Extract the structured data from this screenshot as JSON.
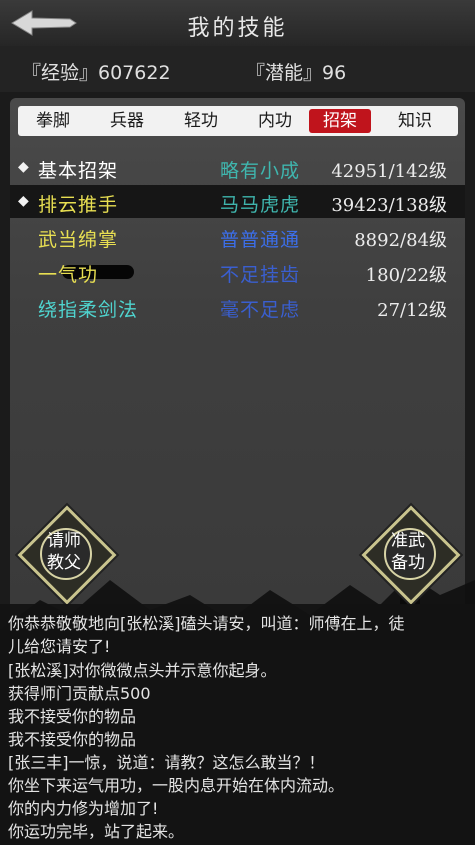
{
  "header": {
    "title": "我的技能",
    "back_icon": "back-arrow-icon"
  },
  "stats": {
    "experience": "『经验』607622",
    "potential": "『潜能』96"
  },
  "tabs": [
    {
      "label": "拳脚",
      "active": false
    },
    {
      "label": "兵器",
      "active": false
    },
    {
      "label": "轻功",
      "active": false
    },
    {
      "label": "内功",
      "active": false
    },
    {
      "label": "招架",
      "active": true
    },
    {
      "label": "知识",
      "active": false
    }
  ],
  "skills": [
    {
      "name": "基本招架",
      "grade": "略有小成",
      "level": "42951/142级",
      "marker": "◆",
      "selected": false
    },
    {
      "name": "排云推手",
      "grade": "马马虎虎",
      "level": "39423/138级",
      "marker": "◆",
      "selected": true
    },
    {
      "name": "武当绵掌",
      "grade": "普普通通",
      "level": "8892/84级",
      "marker": "",
      "selected": false
    },
    {
      "name": "一气功",
      "grade": "不足挂齿",
      "level": "180/22级",
      "marker": "",
      "selected": false
    },
    {
      "name": "绕指柔剑法",
      "grade": "毫不足虑",
      "level": "27/12级",
      "marker": "",
      "selected": false
    }
  ],
  "actions": {
    "ask_master": "请师\n教父",
    "prepare": "准武\n备功"
  },
  "log": [
    "你恭恭敬敬地向[张松溪]磕头请安，叫道：师傅在上，徒",
    "儿给您请安了!",
    "[张松溪]对你微微点头并示意你起身。",
    "获得师门贡献点500",
    "我不接受你的物品",
    "我不接受你的物品",
    "[张三丰]一惊，说道：请教？这怎么敢当？！",
    "你坐下来运气用功，一股内息开始在体内流动。",
    "你的内力修为增加了!",
    "你运功完毕，站了起来。"
  ],
  "colors": {
    "active_tab": "#c0141c",
    "accent_gold": "#c9c48e"
  }
}
